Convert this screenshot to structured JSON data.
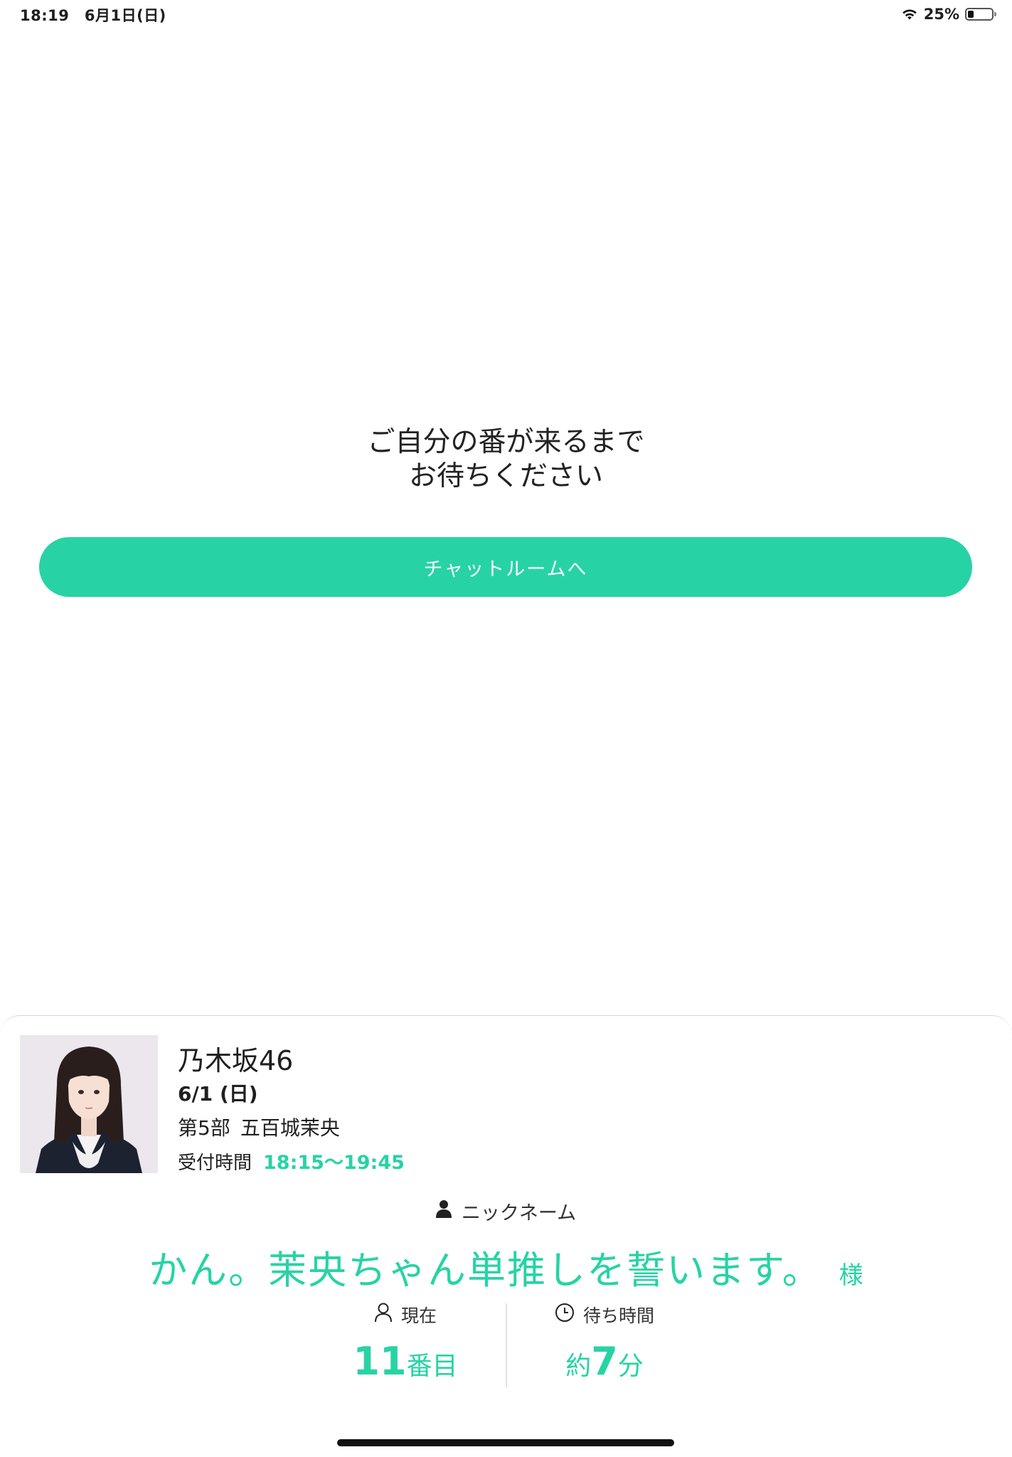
{
  "status_bar": {
    "time": "18:19　6月1日(日)",
    "battery_percent": "25%",
    "battery_level": 0.25
  },
  "main": {
    "message_line1": "ご自分の番が来るまで",
    "message_line2": "お待ちください",
    "chat_button_label": "チャットルームへ"
  },
  "card": {
    "group_name": "乃木坂46",
    "date": "6/1 (日)",
    "session": "第5部",
    "member_name": "五百城茉央",
    "reception_label": "受付時間",
    "reception_time": "18:15〜19:45",
    "nickname_label": "ニックネーム",
    "nickname": "かん。茉央ちゃん単推しを誓います。",
    "nickname_suffix": "様",
    "current_label": "現在",
    "current_number": "11",
    "current_unit": "番目",
    "wait_label": "待ち時間",
    "wait_prefix": "約",
    "wait_number": "7",
    "wait_unit": "分"
  },
  "colors": {
    "accent": "#27d3a4",
    "text": "#1f1f1f"
  }
}
